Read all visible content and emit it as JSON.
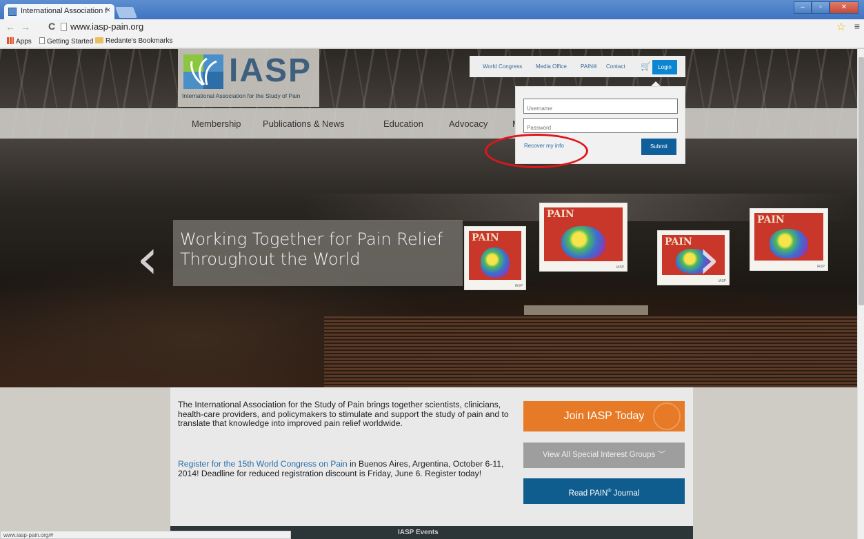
{
  "browser": {
    "tab_title": "International Association f",
    "tab_close": "×",
    "url": "www.iasp-pain.org",
    "bookmarks": [
      "Apps",
      "Getting Started",
      "Redante's Bookmarks"
    ],
    "status_url": "www.iasp-pain.org/#"
  },
  "logo": {
    "text": "IASP",
    "subtitle": "International Association for the Study of Pain"
  },
  "top_nav": {
    "items": [
      "World Congress",
      "Media Office",
      "PAIN®",
      "Contact"
    ],
    "login_label": "Login"
  },
  "login_panel": {
    "username_placeholder": "Username",
    "password_placeholder": "Password",
    "recover_label": "Recover my info",
    "submit_label": "Submit"
  },
  "main_nav": {
    "items": [
      "Membership",
      "Publications & News",
      "Education",
      "Advocacy",
      "M"
    ]
  },
  "hero": {
    "title": "Working Together for Pain Relief Throughout the World",
    "prev_arrow": "‹",
    "next_arrow": "›",
    "poster_word": "PAIN",
    "screen_tag": "IASP"
  },
  "content": {
    "intro": "The International Association for the Study of Pain brings together scientists, clinicians, health-care providers, and policymakers to stimulate and support the study of pain and to translate that knowledge into improved pain relief worldwide.",
    "register_link": "Register for the 15th World Congress on Pain",
    "register_text": " in Buenos Aires, Argentina, October 6-11, 2014! Deadline for reduced registration discount is Friday, June 6. Register today!",
    "join_label": "Join IASP Today",
    "sig_label": "View All Special Interest Groups",
    "read_label_pre": "Read PAIN",
    "read_label_sup": "®",
    "read_label_post": " Journal",
    "footer_heading": "IASP Events"
  },
  "colors": {
    "join": "#e67a26",
    "read": "#0f5d8e",
    "login": "#0d86d1",
    "highlight": "#e0161a"
  }
}
